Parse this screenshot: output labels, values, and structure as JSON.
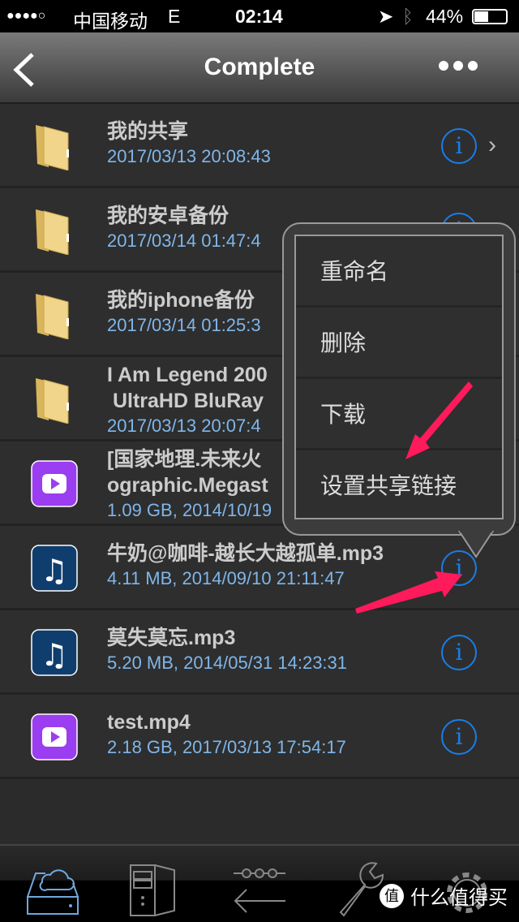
{
  "status": {
    "signal": "●●●●○",
    "carrier": "中国移动",
    "network": "E",
    "time": "02:14",
    "battery": "44%"
  },
  "nav": {
    "title": "Complete",
    "back_icon": "chevron-left-icon",
    "more_icon": "more-dots-icon"
  },
  "files": [
    {
      "type": "folder",
      "name": "我的共享",
      "sub": "2017/03/13 20:08:43",
      "chevron": true
    },
    {
      "type": "folder",
      "name": "我的安卓备份",
      "sub": "2017/03/14 01:47:4",
      "chevron": true
    },
    {
      "type": "folder",
      "name": "我的iphone备份",
      "sub": "2017/03/14 01:25:3"
    },
    {
      "type": "folder",
      "name": "I Am Legend 200\n UltraHD BluRay",
      "sub": "2017/03/13 20:07:4"
    },
    {
      "type": "video",
      "name": "[国家地理.未来火\nographic.Megast",
      "sub": "1.09 GB, 2014/10/19"
    },
    {
      "type": "music",
      "name": "牛奶@咖啡-越长大越孤单.mp3",
      "sub": "4.11 MB, 2014/09/10 21:11:47"
    },
    {
      "type": "music",
      "name": "莫失莫忘.mp3",
      "sub": "5.20 MB, 2014/05/31 14:23:31"
    },
    {
      "type": "video",
      "name": "test.mp4",
      "sub": "2.18 GB, 2017/03/13 17:54:17"
    }
  ],
  "menu": [
    "重命名",
    "删除",
    "下载",
    "设置共享链接"
  ],
  "tabs": [
    "cloud-drive-icon",
    "server-icon",
    "transfer-icon",
    "wrench-icon",
    "gear-icon"
  ],
  "watermark": {
    "badge": "值",
    "text": "什么值得买"
  },
  "colors": {
    "accent": "#1a7de8",
    "subtext": "#7fb6ea",
    "arrow": "#ff1a5c"
  }
}
